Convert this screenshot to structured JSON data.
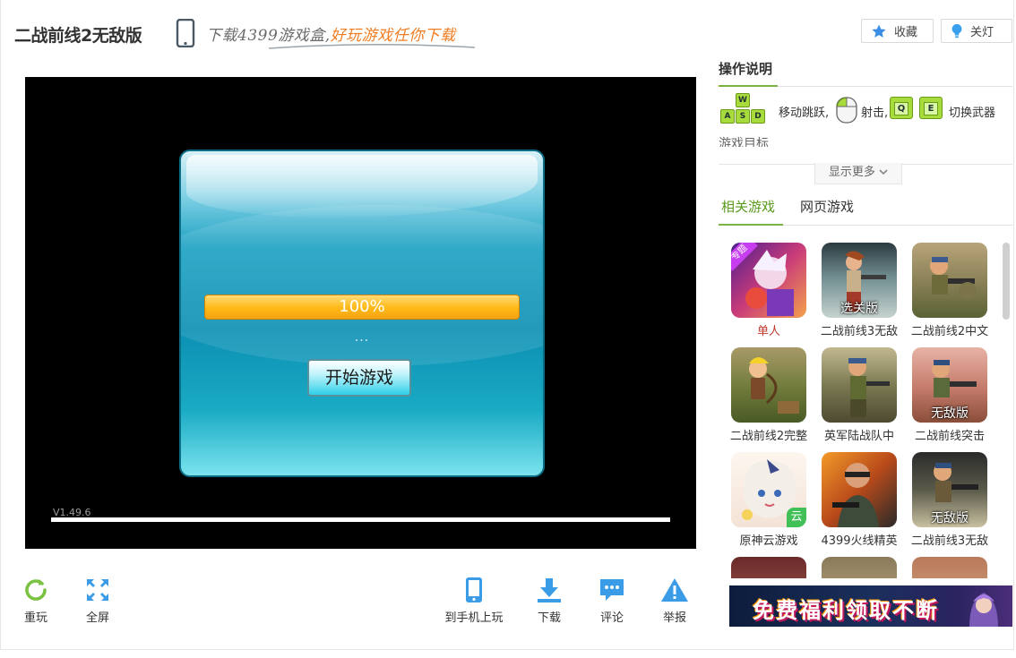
{
  "header": {
    "game_title": "二战前线2无敌版",
    "promo_grey": "下载4399游戏盒,",
    "promo_orange": "好玩游戏任你下载",
    "fav_label": "收藏",
    "light_label": "关灯"
  },
  "game": {
    "progress_text": "100%",
    "progress_value": 100,
    "loading_dots": "...",
    "start_label": "开始游戏",
    "version": "V1.49.6"
  },
  "toolbar": {
    "replay": "重玩",
    "fullscreen": "全屏",
    "phone_play": "到手机上玩",
    "download": "下载",
    "comment": "评论",
    "report": "举报"
  },
  "sidebar": {
    "heading": "操作说明",
    "instr_move": "移动跳跃,",
    "instr_shoot": "射击,",
    "instr_switch": "切换武器",
    "keys": {
      "w": "W",
      "a": "A",
      "s": "S",
      "d": "D",
      "q": "Q",
      "e": "E"
    },
    "goal": "游戏目标",
    "show_more": "显示更多",
    "tabs": {
      "related": "相关游戏",
      "web": "网页游戏"
    },
    "games": [
      {
        "name": "单人",
        "badge": "",
        "tag": "专题"
      },
      {
        "name": "二战前线3无敌",
        "badge": "选关版",
        "tag": ""
      },
      {
        "name": "二战前线2中文",
        "badge": "",
        "tag": ""
      },
      {
        "name": "二战前线2完整",
        "badge": "",
        "tag": ""
      },
      {
        "name": "英军陆战队中",
        "badge": "",
        "tag": ""
      },
      {
        "name": "二战前线突击",
        "badge": "无敌版",
        "tag": ""
      },
      {
        "name": "原神云游戏",
        "badge": "",
        "tag": "云"
      },
      {
        "name": "4399火线精英",
        "badge": "",
        "tag": ""
      },
      {
        "name": "二战前线3无敌",
        "badge": "无敌版",
        "tag": ""
      }
    ],
    "banner_text": "免费福利领取不断"
  }
}
